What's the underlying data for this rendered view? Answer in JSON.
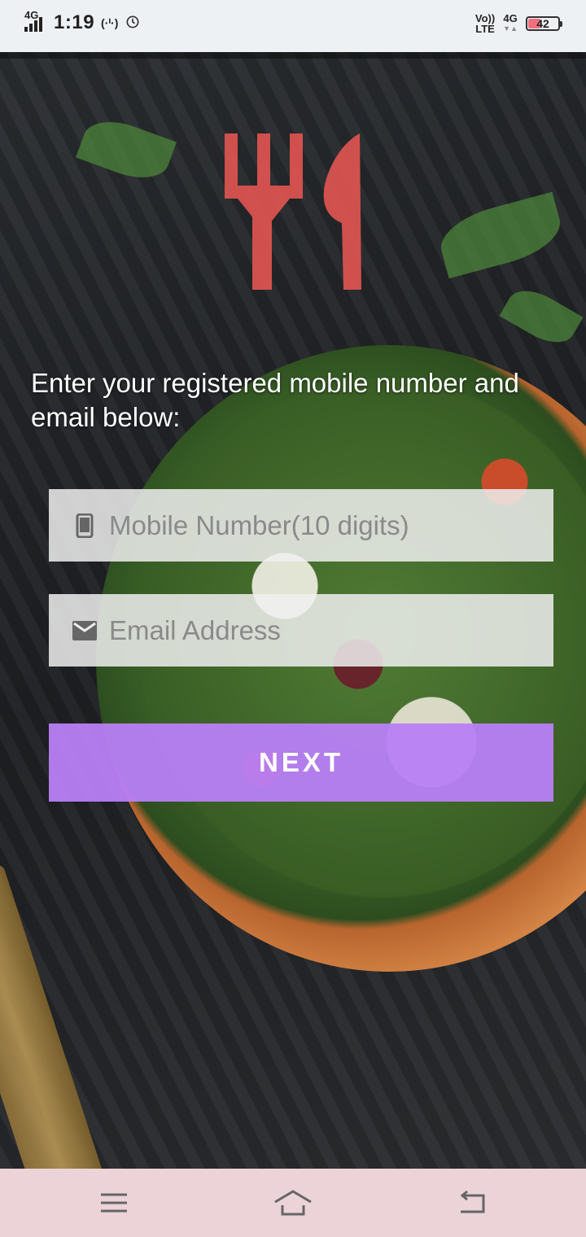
{
  "status_bar": {
    "network_tag": "4G",
    "time": "1:19",
    "volte_top": "Vo))",
    "volte_bottom": "LTE",
    "net_type": "4G",
    "battery_level": "42",
    "battery_color": "#f07080"
  },
  "logo": {
    "icon": "fork-knife-icon",
    "color": "#d9534f"
  },
  "form": {
    "prompt": "Enter your registered mobile number and email below:",
    "mobile": {
      "placeholder": "Mobile Number(10 digits)",
      "icon": "phone-icon",
      "value": ""
    },
    "email": {
      "placeholder": "Email Address",
      "icon": "mail-icon",
      "value": ""
    },
    "next_label": "NEXT",
    "accent": "#b880f5"
  },
  "nav_bar": {
    "menu_icon": "menu-icon",
    "home_icon": "home-icon",
    "back_icon": "back-icon",
    "background": "#ebd3d8"
  }
}
